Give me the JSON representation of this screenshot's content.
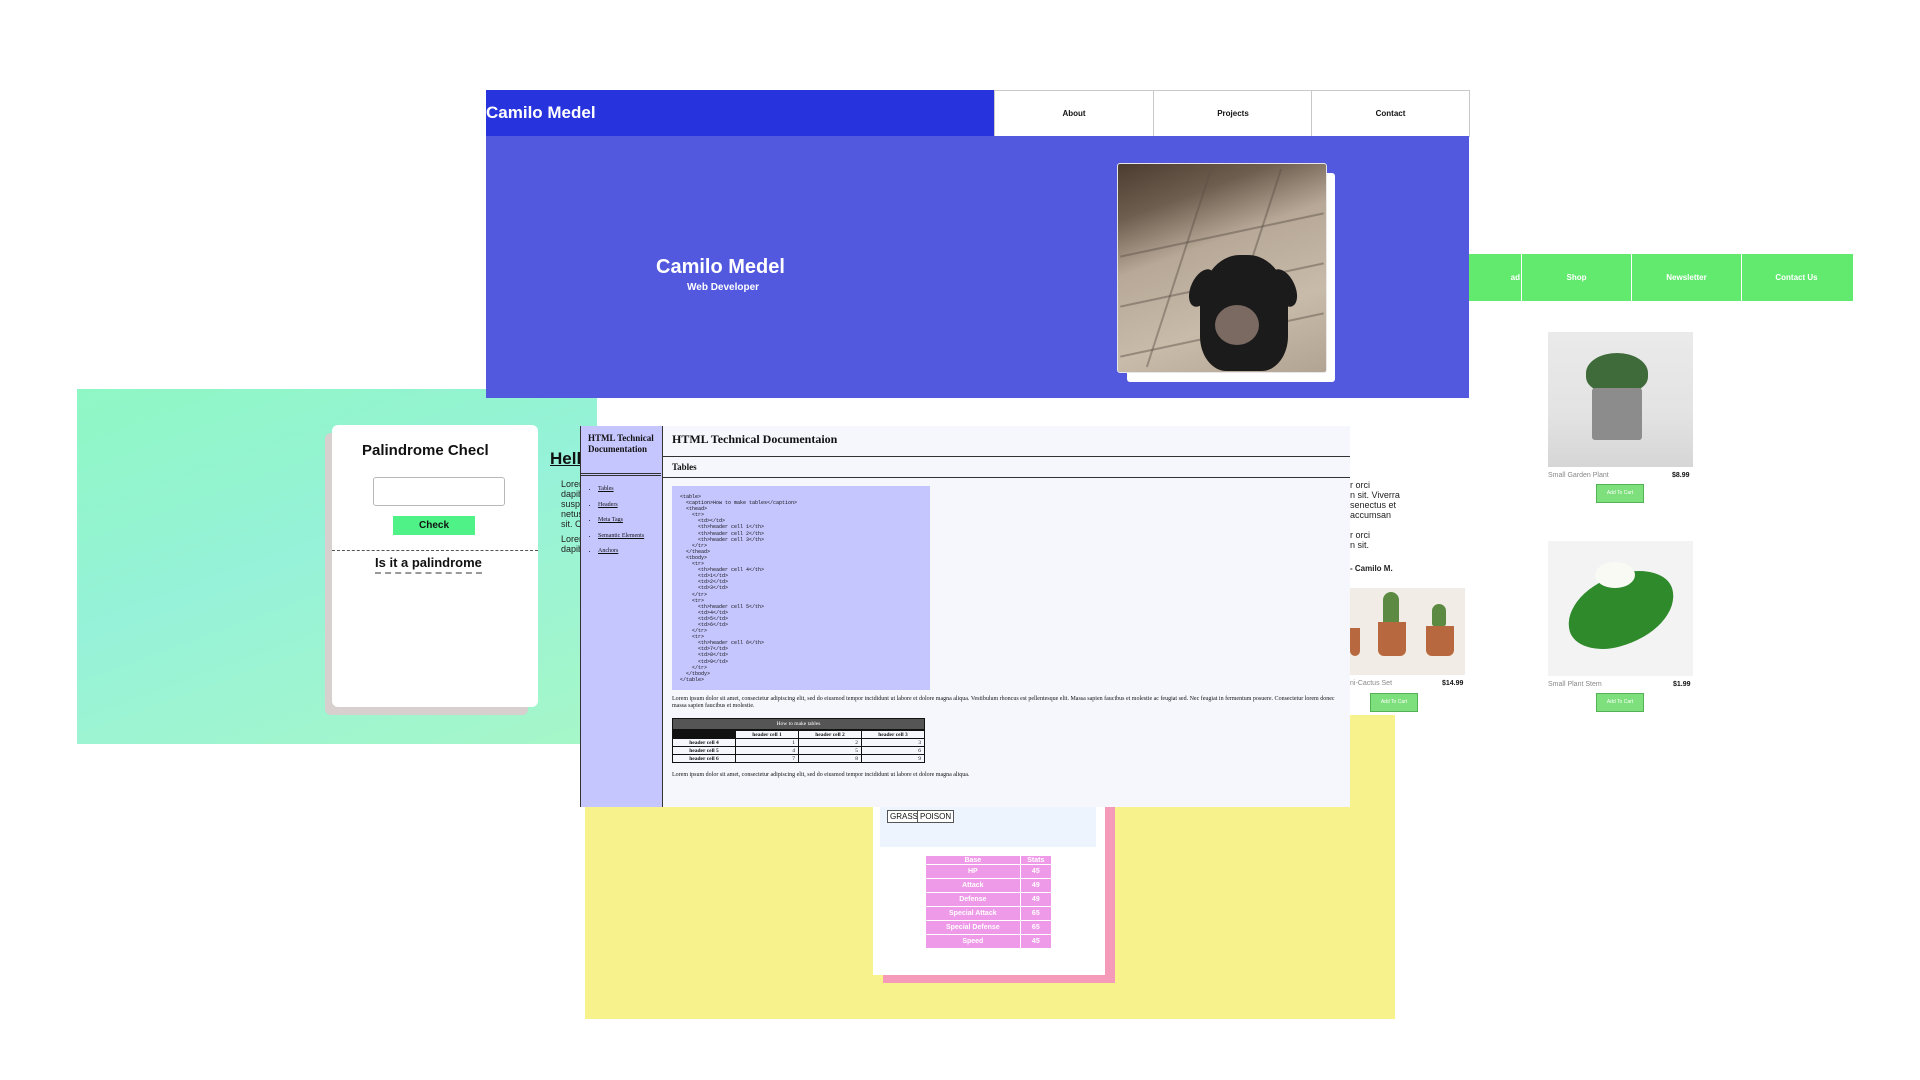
{
  "palindrome": {
    "title": "Palindrome Checker",
    "title_visible": "Palindrome Checl",
    "check_label": "Check",
    "result": "Is it a palindrome"
  },
  "pokemon": {
    "types": [
      "GRASS",
      "POISON"
    ],
    "table": {
      "headers": [
        "Base",
        "Stats"
      ],
      "rows": [
        [
          "HP",
          "45"
        ],
        [
          "Attack",
          "49"
        ],
        [
          "Defense",
          "49"
        ],
        [
          "Special Attack",
          "65"
        ],
        [
          "Special Defense",
          "65"
        ],
        [
          "Speed",
          "45"
        ]
      ]
    }
  },
  "shop": {
    "nav": [
      "ad",
      "Shop",
      "Newsletter",
      "Contact Us"
    ],
    "text_lines": [
      "r orci",
      "n sit. Viverra",
      "senectus et",
      "accumsan",
      "",
      "r orci",
      "n sit."
    ],
    "signature": "- Camilo M.",
    "products": [
      {
        "name": "Small Garden Plant",
        "price": "$8.99",
        "button": "Add To Cart"
      },
      {
        "name": "Small Plant Stem",
        "price": "$1.99",
        "button": "Add To Cart"
      },
      {
        "name": "ni-Cactus Set",
        "price": "$14.99",
        "button": "Add To Cart"
      }
    ]
  },
  "portfolio": {
    "header_title": "Camilo Medel",
    "nav": [
      "About",
      "Projects",
      "Contact"
    ],
    "hero_name": "Camilo Medel",
    "hero_role": "Web Developer",
    "hello": "Hell",
    "lorem_lines_1": [
      "Lorem",
      "dapib",
      "susp",
      "netus",
      "sit. C"
    ],
    "lorem_lines_2": [
      "Lorem",
      "dapib"
    ]
  },
  "docs": {
    "nav_title": "HTML Technical Documentation",
    "nav_items": [
      "Tables",
      "Headers",
      "Meta Tags",
      "Semantic Elements",
      "Anchors"
    ],
    "title": "HTML Technical Documentaion",
    "section": "Tables",
    "code": "<table>\n  <caption>How to make tables</caption>\n  <thead>\n    <tr>\n      <td></td>\n      <th>header cell 1</th>\n      <th>header cell 2</th>\n      <th>header cell 3</th>\n    </tr>\n  </thead>\n  <tbody>\n    <tr>\n      <th>header cell 4</th>\n      <td>1</td>\n      <td>2</td>\n      <td>3</td>\n    </tr>\n    <tr>\n      <th>header cell 5</th>\n      <td>4</td>\n      <td>5</td>\n      <td>6</td>\n    </tr>\n    <tr>\n      <th>header cell 6</th>\n      <td>7</td>\n      <td>8</td>\n      <td>9</td>\n    </tr>\n  </tbody>\n</table>",
    "para1": "Lorem ipsum dolor sit amet, consectetur adipiscing elit, sed do eiusmod tempor incididunt ut labore et dolore magna aliqua. Vestibulum rhoncus est pellentesque elit. Massa sapien faucibus et molestie ac feugiat sed. Nec feugiat in fermentum posuere. Consectetur lorem donec massa sapien faucibus et molestie.",
    "table": {
      "caption": "How to make tables",
      "headers": [
        "header cell 1",
        "header cell 2",
        "header cell 3"
      ],
      "rows": [
        {
          "head": "header cell 4",
          "cells": [
            "1",
            "2",
            "3"
          ]
        },
        {
          "head": "header cell 5",
          "cells": [
            "4",
            "5",
            "6"
          ]
        },
        {
          "head": "header cell 6",
          "cells": [
            "7",
            "8",
            "9"
          ]
        }
      ]
    },
    "para2": "Lorem ipsum dolor sit amet, consectetur adipiscing elit, sed do eiusmod tempor incididunt ut labore et dolore magna aliqua."
  },
  "colors": {
    "portfolio_header": "#2733dd",
    "portfolio_hero": "#5259de",
    "shop_green": "#62ea6e",
    "palindrome_green": "#4ff286",
    "docs_lavender": "#c6c6ff",
    "yellow_bg": "#f7f28b",
    "pokemon_pink": "#ee9ae8"
  }
}
